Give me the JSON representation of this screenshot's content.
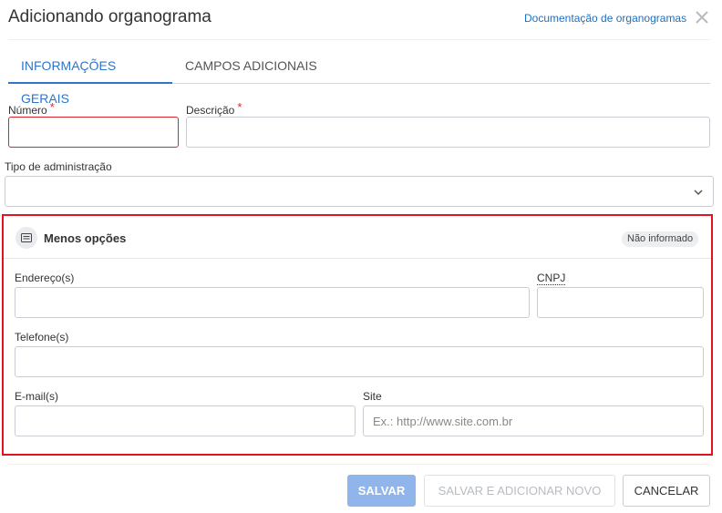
{
  "dialog": {
    "title": "Adicionando organograma",
    "doc_link": "Documentação de organogramas"
  },
  "tabs": [
    {
      "label": "INFORMAÇÕES GERAIS",
      "active": true
    },
    {
      "label": "CAMPOS ADICIONAIS",
      "active": false
    }
  ],
  "form": {
    "numero": {
      "label": "Número",
      "required_mark": "*",
      "value": ""
    },
    "descricao": {
      "label": "Descrição",
      "required_mark": "*",
      "value": ""
    },
    "tipo_administracao": {
      "label": "Tipo de administração",
      "value": ""
    }
  },
  "section": {
    "title": "Menos opções",
    "badge": "Não informado",
    "enderecos": {
      "label": "Endereço(s)",
      "value": ""
    },
    "cnpj": {
      "label": "CNPJ",
      "value": ""
    },
    "telefones": {
      "label": "Telefone(s)",
      "value": ""
    },
    "emails": {
      "label": "E-mail(s)",
      "value": ""
    },
    "site": {
      "label": "Site",
      "placeholder": "Ex.: http://www.site.com.br",
      "value": ""
    }
  },
  "footer": {
    "save": "SALVAR",
    "save_new": "SALVAR E ADICIONAR NOVO",
    "cancel": "CANCELAR"
  },
  "colors": {
    "accent": "#2f75c8",
    "link": "#1f6fbf",
    "required": "#d9262b",
    "highlight_border": "#e0141e",
    "save_button": "#8fb5ea"
  },
  "icons": {
    "close": "close-icon",
    "dropdown": "chevron-down-icon",
    "section": "list-icon"
  }
}
